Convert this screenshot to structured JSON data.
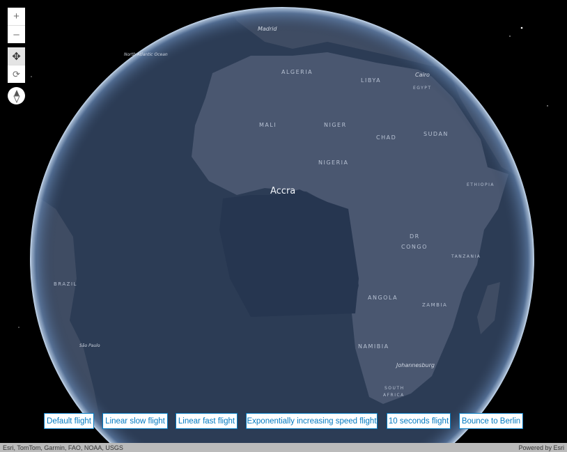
{
  "controls": {
    "zoom_in_icon": "plus-icon",
    "zoom_out_icon": "minus-icon",
    "pan_icon": "move-arrows-icon",
    "rotate_icon": "rotate-icon",
    "compass_icon": "compass-icon"
  },
  "map": {
    "labels": {
      "north_atlantic": "North Atlantic Ocean",
      "madrid": "Madrid",
      "algeria": "ALGERIA",
      "libya": "LIBYA",
      "cairo": "Cairo",
      "egypt": "EGYPT",
      "mali": "MALI",
      "niger": "NIGER",
      "chad": "CHAD",
      "sudan": "SUDAN",
      "nigeria": "NIGERIA",
      "ethiopia": "ETHIOPIA",
      "accra": "Accra",
      "dr": "DR",
      "congo": "CONGO",
      "tanzania": "TANZANIA",
      "angola": "ANGOLA",
      "zambia": "ZAMBIA",
      "namibia": "NAMIBIA",
      "johannesburg": "Johannesburg",
      "south": "SOUTH",
      "africa": "AFRICA",
      "brazil": "BRAZIL",
      "sao_paulo": "São Paulo"
    },
    "colors": {
      "ocean": "#2c3c55",
      "land": "#4a5770",
      "atmosphere": "#8fb0d8",
      "background": "#000000"
    }
  },
  "buttons": [
    {
      "label": "Default flight"
    },
    {
      "label": "Linear slow flight"
    },
    {
      "label": "Linear fast flight"
    },
    {
      "label": "Exponentially increasing speed flight"
    },
    {
      "label": "10 seconds flight"
    },
    {
      "label": "Bounce to Berlin"
    }
  ],
  "attribution": {
    "sources": "Esri, TomTom, Garmin, FAO, NOAA, USGS",
    "powered_by": "Powered by Esri"
  },
  "accent_color": "#0079c1"
}
